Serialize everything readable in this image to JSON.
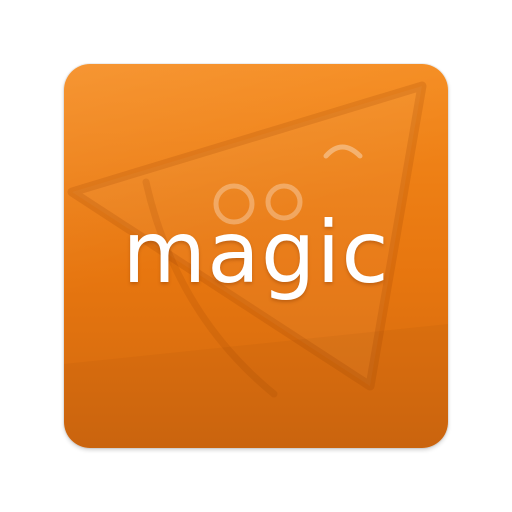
{
  "app_icon": {
    "wordmark": "magic",
    "icon_name": "pizza-slice-icon",
    "colors": {
      "tile_top": "#f58a1c",
      "tile_bottom": "#d0680f",
      "text": "#ffffff"
    }
  }
}
